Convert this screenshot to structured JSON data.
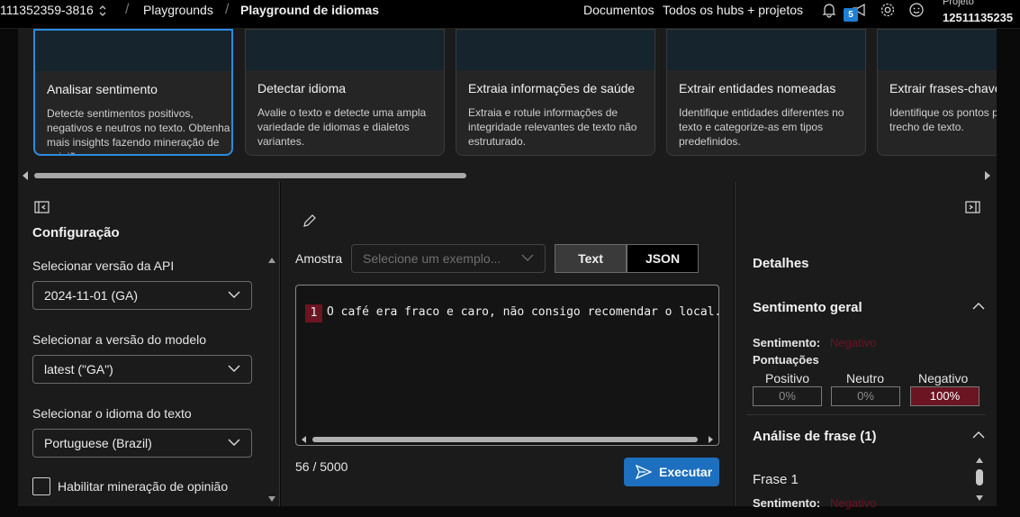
{
  "topbar": {
    "project_id": "111352359-3816",
    "breadcrumb_playgrounds": "Playgrounds",
    "breadcrumb_current": "Playground de idiomas",
    "documents_link": "Documentos",
    "hubs_link": "Todos os hubs + projetos",
    "notification_count": "5",
    "project_label": "Projeto",
    "project_name": "12511135235"
  },
  "cards": [
    {
      "title": "Analisar sentimento",
      "desc": "Detecte sentimentos positivos, negativos e neutros no texto. Obtenha mais insights fazendo mineração de opiniões."
    },
    {
      "title": "Detectar idioma",
      "desc": "Avalie o texto e detecte uma ampla variedade de idiomas e dialetos variantes."
    },
    {
      "title": "Extraia informações de saúde",
      "desc": "Extraia e rotule informações de integridade relevantes de texto não estruturado."
    },
    {
      "title": "Extrair entidades nomeadas",
      "desc": "Identifique entidades diferentes no texto e categorize-as em tipos predefinidos."
    },
    {
      "title": "Extrair frases-chave",
      "desc": "Identifique os pontos principais em um trecho de texto."
    }
  ],
  "config": {
    "title": "Configuração",
    "api_label": "Selecionar versão da API",
    "api_value": "2024-11-01 (GA)",
    "model_label": "Selecionar a versão do modelo",
    "model_value": "latest (\"GA\")",
    "lang_label": "Selecionar o idioma do texto",
    "lang_value": "Portuguese (Brazil)",
    "opinion_label": "Habilitar mineração de opinião"
  },
  "editor": {
    "sample_label": "Amostra",
    "sample_placeholder": "Selecione um exemplo...",
    "tab_text": "Text",
    "tab_json": "JSON",
    "line_number": "1",
    "line_text": "O café era fraco e caro, não consigo recomendar o local.",
    "char_count": "56 / 5000",
    "run_label": "Executar"
  },
  "details": {
    "title": "Detalhes",
    "overall_title": "Sentimento geral",
    "sentiment_label": "Sentimento:",
    "sentiment_value": "Negativo",
    "scores_label": "Pontuações",
    "positive_label": "Positivo",
    "neutral_label": "Neutro",
    "negative_label": "Negativo",
    "positive_value": "0%",
    "neutral_value": "0%",
    "negative_value": "100%",
    "sentence_title": "Análise de frase (1)",
    "sentence_item": "Frase 1",
    "sentence_sentiment_label": "Sentimento:",
    "sentence_sentiment_value": "Negativo"
  },
  "colors": {
    "accent": "#1d6fbf",
    "selected_border": "#2b8be0",
    "negative": "#6b1522"
  }
}
